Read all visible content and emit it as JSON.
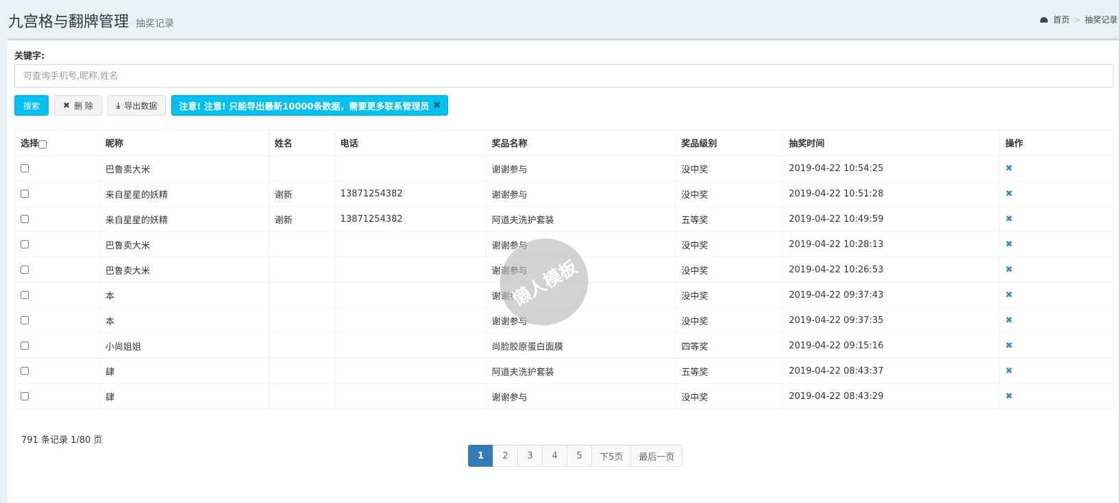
{
  "header": {
    "title": "九宫格与翻牌管理",
    "subtitle": "抽奖记录"
  },
  "breadcrumb": {
    "home": "首页",
    "current": "抽奖记录"
  },
  "search": {
    "label": "关键字:",
    "placeholder": "可查询手机号,昵称,姓名",
    "value": ""
  },
  "toolbar": {
    "search_label": "搜索",
    "delete_label": "删 除",
    "export_label": "导出数据",
    "alert_text": "注意! 注意! 只能导出最新10000条数据，需要更多联系管理员"
  },
  "table": {
    "headers": [
      "选择",
      "昵称",
      "姓名",
      "电话",
      "奖品名称",
      "奖品级别",
      "抽奖时间",
      "操作"
    ],
    "rows": [
      {
        "nick": "巴鲁卖大米",
        "name": "",
        "phone": "",
        "prize": "谢谢参与",
        "level": "没中奖",
        "time": "2019-04-22 10:54:25"
      },
      {
        "nick": "来自星星的妖精",
        "name": "谢新",
        "phone": "13871254382",
        "prize": "谢谢参与",
        "level": "没中奖",
        "time": "2019-04-22 10:51:28"
      },
      {
        "nick": "来自星星的妖精",
        "name": "谢新",
        "phone": "13871254382",
        "prize": "阿道夫洗护套装",
        "level": "五等奖",
        "time": "2019-04-22 10:49:59"
      },
      {
        "nick": "巴鲁卖大米",
        "name": "",
        "phone": "",
        "prize": "谢谢参与",
        "level": "没中奖",
        "time": "2019-04-22 10:28:13"
      },
      {
        "nick": "巴鲁卖大米",
        "name": "",
        "phone": "",
        "prize": "谢谢参与",
        "level": "没中奖",
        "time": "2019-04-22 10:26:53"
      },
      {
        "nick": "本",
        "name": "",
        "phone": "",
        "prize": "谢谢参与",
        "level": "没中奖",
        "time": "2019-04-22 09:37:43"
      },
      {
        "nick": "本",
        "name": "",
        "phone": "",
        "prize": "谢谢参与",
        "level": "没中奖",
        "time": "2019-04-22 09:37:35"
      },
      {
        "nick": "小尚姐姐",
        "name": "",
        "phone": "",
        "prize": "尚脸胶原蛋白面膜",
        "level": "四等奖",
        "time": "2019-04-22 09:15:16"
      },
      {
        "nick": "肆",
        "name": "",
        "phone": "",
        "prize": "阿道夫洗护套装",
        "level": "五等奖",
        "time": "2019-04-22 08:43:37"
      },
      {
        "nick": "肆",
        "name": "",
        "phone": "",
        "prize": "谢谢参与",
        "level": "没中奖",
        "time": "2019-04-22 08:43:29"
      }
    ]
  },
  "footer": {
    "count_text": "791 条记录 1/80 页"
  },
  "pagination": [
    "1",
    "2",
    "3",
    "4",
    "5",
    "下5页",
    "最后一页"
  ],
  "watermark": "懒人模板",
  "colors": {
    "accent": "#00c0ef",
    "primary": "#337ab7",
    "delete": "#3c8dbc"
  }
}
